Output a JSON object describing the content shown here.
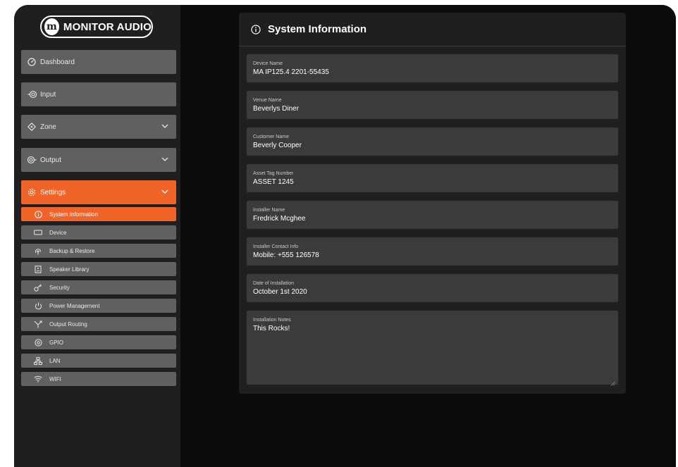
{
  "brand": {
    "logo_text": "MONITOR AUDIO"
  },
  "sidebar": {
    "items": [
      {
        "label": "Dashboard",
        "icon": "dashboard-icon"
      },
      {
        "label": "Input",
        "icon": "input-icon"
      },
      {
        "label": "Zone",
        "icon": "zone-icon"
      },
      {
        "label": "Output",
        "icon": "output-icon"
      },
      {
        "label": "Settings",
        "icon": "gear-icon"
      }
    ],
    "settings_subitems": [
      {
        "label": "System Information",
        "icon": "info-icon"
      },
      {
        "label": "Device",
        "icon": "device-icon"
      },
      {
        "label": "Backup & Restore",
        "icon": "backup-icon"
      },
      {
        "label": "Speaker Library",
        "icon": "speaker-icon"
      },
      {
        "label": "Security",
        "icon": "key-icon"
      },
      {
        "label": "Power Management",
        "icon": "power-icon"
      },
      {
        "label": "Output Routing",
        "icon": "routing-icon"
      },
      {
        "label": "GPIO",
        "icon": "gpio-icon"
      },
      {
        "label": "LAN",
        "icon": "lan-icon"
      },
      {
        "label": "WIFI",
        "icon": "wifi-icon"
      }
    ]
  },
  "panel": {
    "title": "System Information",
    "fields": [
      {
        "label": "Device Name",
        "value": "MA IP125.4 2201-55435"
      },
      {
        "label": "Venue Name",
        "value": "Beverlys Diner"
      },
      {
        "label": "Customer Name",
        "value": "Beverly Cooper"
      },
      {
        "label": "Asset Tag Number",
        "value": "ASSET 1245"
      },
      {
        "label": "Installer Name",
        "value": "Fredrick Mcghee"
      },
      {
        "label": "Installer Contact Info",
        "value": "Mobile: +555 126578"
      },
      {
        "label": "Date of Installation",
        "value": "October 1st 2020"
      },
      {
        "label": "Installation Notes",
        "value": "This Rocks!"
      }
    ]
  },
  "colors": {
    "accent": "#f0642a",
    "sidebar_item": "#5e6061",
    "panel": "#1f1f21",
    "field": "#3b3b3d",
    "background": "#0b0b0c"
  }
}
